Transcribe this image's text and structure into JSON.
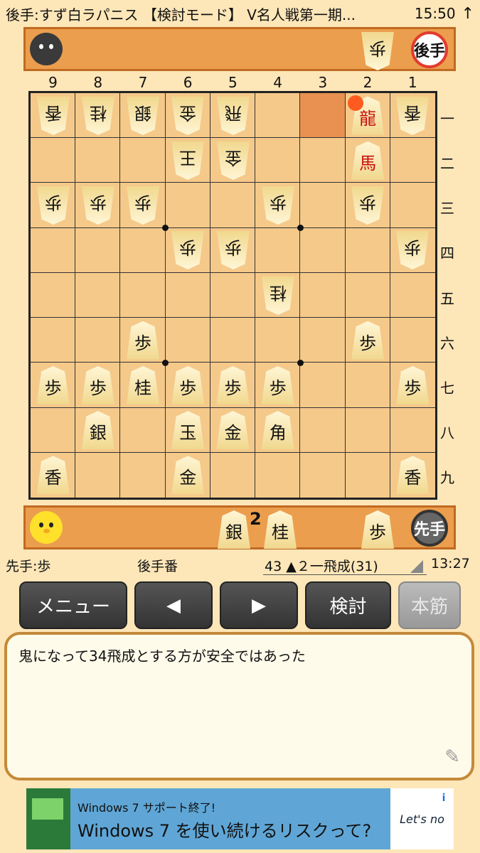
{
  "status_bar": {
    "title": "後手:すず白ラパニス 【検討モード】 V名人戦第一期...",
    "time": "15:50",
    "arrow": "↑"
  },
  "gote_stand": {
    "hand_pieces": [
      {
        "label": "歩",
        "count": ""
      }
    ],
    "turn_badge": "後手"
  },
  "sente_stand": {
    "hand_pieces": [
      {
        "label": "銀",
        "count": "2"
      },
      {
        "label": "桂",
        "count": ""
      },
      {
        "label": "歩",
        "count": ""
      }
    ],
    "turn_badge": "先手"
  },
  "board": {
    "file_labels": [
      "9",
      "8",
      "7",
      "6",
      "5",
      "4",
      "3",
      "2",
      "1"
    ],
    "rank_labels": [
      "一",
      "二",
      "三",
      "四",
      "五",
      "六",
      "七",
      "八",
      "九"
    ],
    "highlight_square": {
      "file": 3,
      "rank": 1
    },
    "last_move_marker": {
      "file": 2,
      "rank": 1
    },
    "pieces": [
      {
        "file": 9,
        "rank": 1,
        "label": "香",
        "owner": "gote"
      },
      {
        "file": 8,
        "rank": 1,
        "label": "桂",
        "owner": "gote"
      },
      {
        "file": 7,
        "rank": 1,
        "label": "銀",
        "owner": "gote"
      },
      {
        "file": 6,
        "rank": 1,
        "label": "金",
        "owner": "gote"
      },
      {
        "file": 5,
        "rank": 1,
        "label": "飛",
        "owner": "gote"
      },
      {
        "file": 2,
        "rank": 1,
        "label": "龍",
        "owner": "sente",
        "promoted": true
      },
      {
        "file": 1,
        "rank": 1,
        "label": "香",
        "owner": "gote"
      },
      {
        "file": 6,
        "rank": 2,
        "label": "王",
        "owner": "gote"
      },
      {
        "file": 5,
        "rank": 2,
        "label": "金",
        "owner": "gote"
      },
      {
        "file": 2,
        "rank": 2,
        "label": "馬",
        "owner": "sente",
        "promoted": true
      },
      {
        "file": 9,
        "rank": 3,
        "label": "歩",
        "owner": "gote"
      },
      {
        "file": 8,
        "rank": 3,
        "label": "歩",
        "owner": "gote"
      },
      {
        "file": 7,
        "rank": 3,
        "label": "歩",
        "owner": "gote"
      },
      {
        "file": 4,
        "rank": 3,
        "label": "歩",
        "owner": "gote"
      },
      {
        "file": 2,
        "rank": 3,
        "label": "歩",
        "owner": "gote"
      },
      {
        "file": 6,
        "rank": 4,
        "label": "歩",
        "owner": "gote"
      },
      {
        "file": 5,
        "rank": 4,
        "label": "歩",
        "owner": "gote"
      },
      {
        "file": 1,
        "rank": 4,
        "label": "歩",
        "owner": "gote"
      },
      {
        "file": 4,
        "rank": 5,
        "label": "桂",
        "owner": "gote"
      },
      {
        "file": 7,
        "rank": 6,
        "label": "歩",
        "owner": "sente"
      },
      {
        "file": 2,
        "rank": 6,
        "label": "歩",
        "owner": "sente"
      },
      {
        "file": 9,
        "rank": 7,
        "label": "歩",
        "owner": "sente"
      },
      {
        "file": 8,
        "rank": 7,
        "label": "歩",
        "owner": "sente"
      },
      {
        "file": 7,
        "rank": 7,
        "label": "桂",
        "owner": "sente"
      },
      {
        "file": 6,
        "rank": 7,
        "label": "歩",
        "owner": "sente"
      },
      {
        "file": 5,
        "rank": 7,
        "label": "歩",
        "owner": "sente"
      },
      {
        "file": 4,
        "rank": 7,
        "label": "歩",
        "owner": "sente"
      },
      {
        "file": 1,
        "rank": 7,
        "label": "歩",
        "owner": "sente"
      },
      {
        "file": 8,
        "rank": 8,
        "label": "銀",
        "owner": "sente"
      },
      {
        "file": 6,
        "rank": 8,
        "label": "玉",
        "owner": "sente"
      },
      {
        "file": 5,
        "rank": 8,
        "label": "金",
        "owner": "sente"
      },
      {
        "file": 4,
        "rank": 8,
        "label": "角",
        "owner": "sente"
      },
      {
        "file": 9,
        "rank": 9,
        "label": "香",
        "owner": "sente"
      },
      {
        "file": 6,
        "rank": 9,
        "label": "金",
        "owner": "sente"
      },
      {
        "file": 1,
        "rank": 9,
        "label": "香",
        "owner": "sente"
      }
    ]
  },
  "info_bar": {
    "sente_hand_text": "先手:歩",
    "turn_text": "後手番",
    "move_text": "43 ▲２一飛成(31)",
    "clock": "13:27"
  },
  "buttons": {
    "menu": "メニュー",
    "prev": "◀",
    "next": "▶",
    "analyze": "検討",
    "main_line": "本筋"
  },
  "comment": {
    "text": "鬼になって34飛成とする方が安全ではあった",
    "edit_icon": "✎"
  },
  "ad": {
    "line1": "Windows 7 サポート終了!",
    "line2": "Windows 7 を使い続けるリスクって?",
    "logo_text": "Let's no",
    "info_icon": "i"
  }
}
